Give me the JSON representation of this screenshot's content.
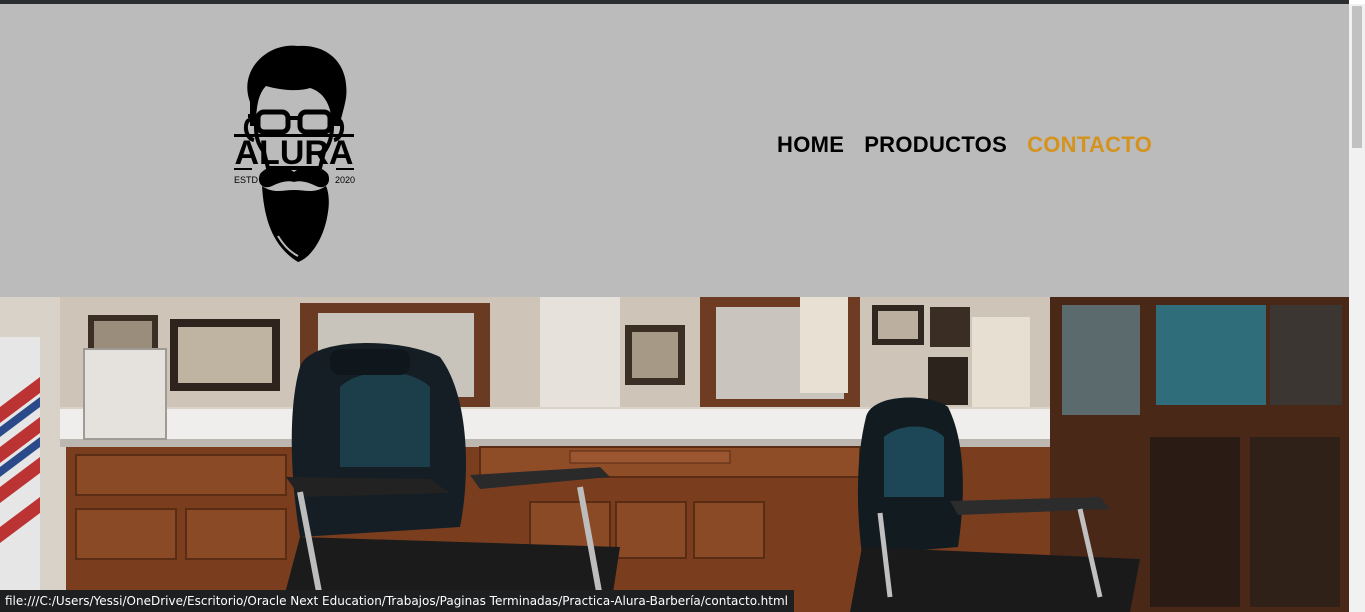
{
  "logo": {
    "brand": "ALURA",
    "established_left": "ESTD",
    "established_right": "2020",
    "icon": "bearded-man-glasses-logo"
  },
  "nav": {
    "items": [
      {
        "label": "HOME",
        "active": false
      },
      {
        "label": "PRODUCTOS",
        "active": false
      },
      {
        "label": "CONTACTO",
        "active": true
      }
    ],
    "active_color": "#d4931f"
  },
  "hero": {
    "icon": "barbershop-interior-photo"
  },
  "status_bar": {
    "url": "file:///C:/Users/Yessi/OneDrive/Escritorio/Oracle Next Education/Trabajos/Paginas Terminadas/Practica-Alura-Barbería/contacto.html"
  },
  "colors": {
    "header_bg": "#bbbbbb",
    "accent": "#d4931f"
  }
}
